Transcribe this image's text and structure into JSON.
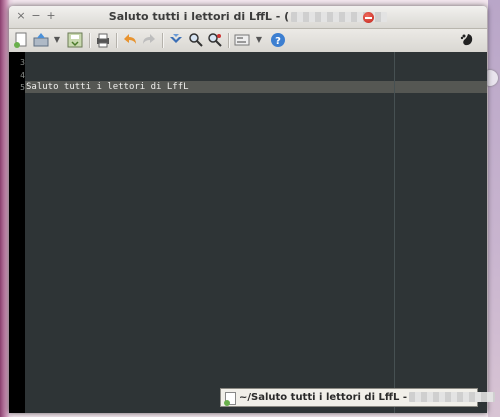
{
  "window": {
    "title": "Saluto tutti i lettori di LffL - (",
    "controls": {
      "close": "×",
      "minimize": "−",
      "maximize": "+"
    }
  },
  "toolbar": {
    "icons": [
      "new-document-icon",
      "open-icon",
      "dropdown-arrow-icon",
      "save-icon",
      "print-icon",
      "undo-icon",
      "redo-icon",
      "jump-icon",
      "find-icon",
      "find-replace-icon",
      "preferences-icon",
      "help-icon",
      "gnome-icon"
    ]
  },
  "editor": {
    "line_numbers": [
      "3",
      "4",
      "5"
    ],
    "current_line_text": "Saluto tutti i lettori di LffL"
  },
  "tooltip": {
    "text": "~/Saluto tutti i lettori di LffL -"
  },
  "colors": {
    "editor_bg": "#2e3436",
    "current_line_bg": "#555753",
    "text": "#eeeeec"
  }
}
